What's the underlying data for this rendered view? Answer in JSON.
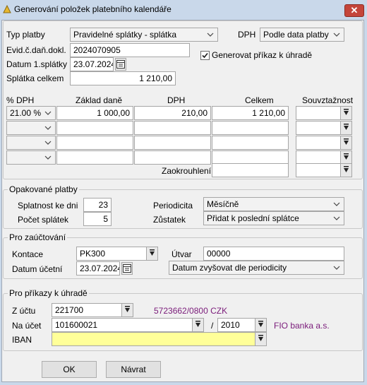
{
  "window": {
    "title": "Generování položek platebního kalendáře",
    "close_label": "✕"
  },
  "form": {
    "typ_platby_label": "Typ platby",
    "typ_platby_value": "Pravidelné splátky - splátka",
    "dph_label": "DPH",
    "dph_value": "Podle data platby",
    "evid_label": "Evid.č.daň.dokl.",
    "evid_value": "2024070905",
    "generovat_label": "Generovat příkaz k úhradě",
    "generovat_checked": true,
    "datum_label": "Datum 1.splátky",
    "datum_value": "23.07.2024",
    "splatka_label": "Splátka celkem",
    "splatka_value": "1 210,00"
  },
  "vat_table": {
    "headers": [
      "% DPH",
      "Základ daně",
      "DPH",
      "Celkem",
      "Souvztažnost"
    ],
    "rows": [
      {
        "rate": "21.00 %",
        "base": "1 000,00",
        "vat": "210,00",
        "total": "1 210,00",
        "souv": ""
      },
      {
        "rate": "",
        "base": "",
        "vat": "",
        "total": "",
        "souv": ""
      },
      {
        "rate": "",
        "base": "",
        "vat": "",
        "total": "",
        "souv": ""
      },
      {
        "rate": "",
        "base": "",
        "vat": "",
        "total": "",
        "souv": ""
      }
    ],
    "zaokrouhleni_label": "Zaokrouhlení",
    "zaokrouhleni_value": ""
  },
  "opakovane": {
    "title": "Opakované platby",
    "splatnost_label": "Splatnost ke dni",
    "splatnost_value": "23",
    "pocet_label": "Počet splátek",
    "pocet_value": "5",
    "periodicita_label": "Periodicita",
    "periodicita_value": "Měsíčně",
    "zustatek_label": "Zůstatek",
    "zustatek_value": "Přidat k poslední splátce"
  },
  "zauctovani": {
    "title": "Pro zaúčtování",
    "kontace_label": "Kontace",
    "kontace_value": "PK300",
    "utvar_label": "Útvar",
    "utvar_value": "00000",
    "datum_label": "Datum účetní",
    "datum_value": "23.07.2024",
    "datum_mode": "Datum zvyšovat dle periodicity"
  },
  "prikazy": {
    "title": "Pro příkazy k úhradě",
    "z_uctu_label": "Z účtu",
    "z_uctu_value": "221700",
    "z_uctu_info": "5723662/0800 CZK",
    "na_ucet_label": "Na účet",
    "na_ucet_value": "101600021",
    "slash": "/",
    "bank_code": "2010",
    "bank_name": "FIO banka a.s.",
    "iban_label": "IBAN",
    "iban_value": ""
  },
  "buttons": {
    "ok": "OK",
    "navrat": "Návrat"
  },
  "colors": {
    "title_bg": "#c9d8ea",
    "close_bg": "#c4453a",
    "info_text": "#7a1b7a",
    "iban_bg": "#ffff99"
  }
}
